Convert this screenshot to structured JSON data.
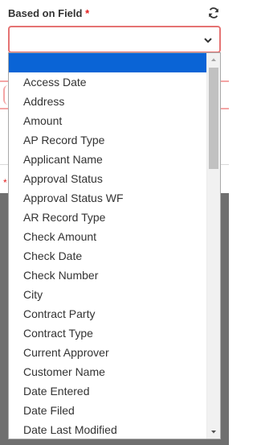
{
  "field": {
    "label": "Based on Field",
    "required_marker": "*",
    "selected_value": ""
  },
  "dropdown": {
    "options": [
      "",
      "Access Date",
      "Address",
      "Amount",
      "AP Record Type",
      "Applicant Name",
      "Approval Status",
      "Approval Status WF",
      "AR Record Type",
      "Check Amount",
      "Check Date",
      "Check Number",
      "City",
      "Contract Party",
      "Contract Type",
      "Current Approver",
      "Customer Name",
      "Date Entered",
      "Date Filed",
      "Date Last Modified"
    ],
    "selected_index": 0
  },
  "background": {
    "required_marker": "*"
  },
  "icons": {
    "refresh": "refresh-icon",
    "chevron": "chevron-down-icon",
    "scroll_up": "scroll-up-arrow-icon",
    "scroll_down": "scroll-down-arrow-icon"
  },
  "colors": {
    "selected_option": "#0a64d6",
    "required": "#e41e1e",
    "field_border": "#e57373"
  }
}
